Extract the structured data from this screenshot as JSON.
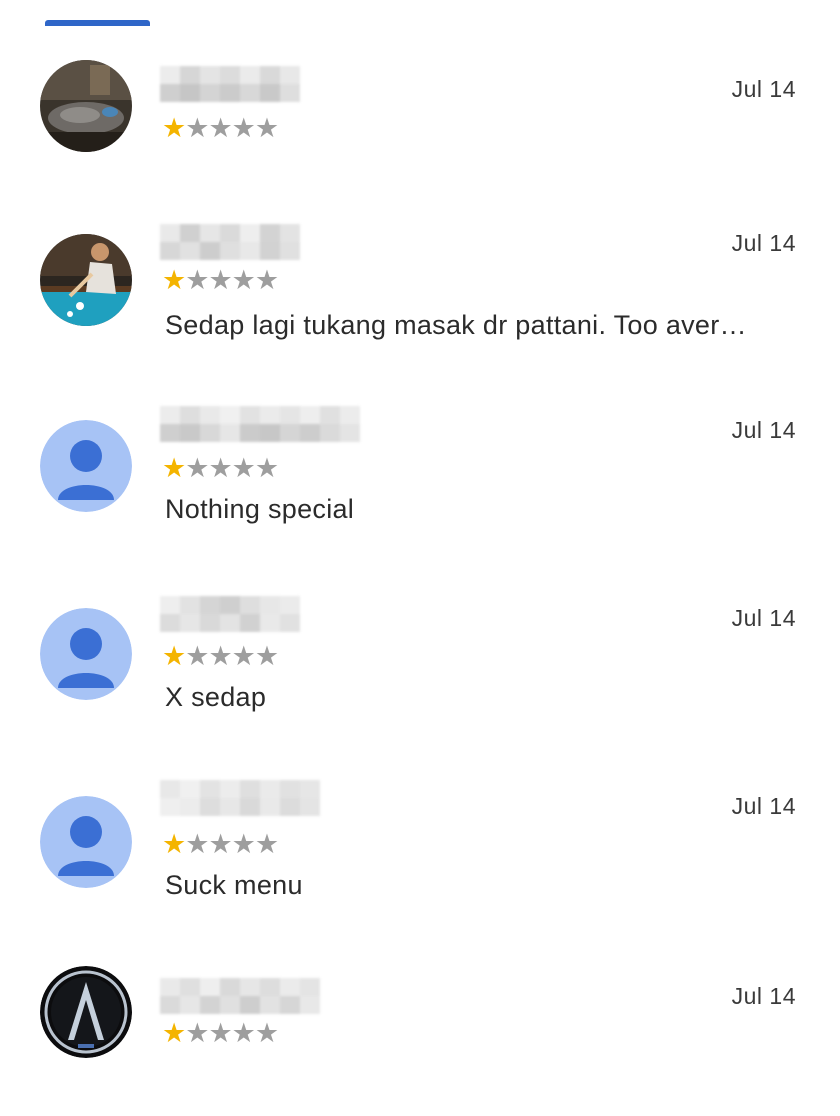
{
  "colors": {
    "accent": "#2f66c8",
    "star_filled": "#f4b400",
    "star_empty": "#9e9e9e",
    "avatar_default_bg": "#a7c3f5",
    "avatar_default_fg": "#3b6fd4"
  },
  "reviews": [
    {
      "avatar": "photo-avatar-dark-interior",
      "date": "Jul 14",
      "rating": 1,
      "rating_max": 5,
      "stars": "★★★★★",
      "text": ""
    },
    {
      "avatar": "photo-avatar-billiards-player",
      "date": "Jul 14",
      "rating": 1,
      "rating_max": 5,
      "stars": "★★★★★",
      "text": "Sedap lagi tukang masak dr pattani. Too aver…"
    },
    {
      "avatar": "default-person-avatar",
      "date": "Jul 14",
      "rating": 1,
      "rating_max": 5,
      "stars": "★★★★★",
      "text": "Nothing special"
    },
    {
      "avatar": "default-person-avatar",
      "date": "Jul 14",
      "rating": 1,
      "rating_max": 5,
      "stars": "★★★★★",
      "text": "X sedap"
    },
    {
      "avatar": "default-person-avatar",
      "date": "Jul 14",
      "rating": 1,
      "rating_max": 5,
      "stars": "★★★★★",
      "text": "Suck menu"
    },
    {
      "avatar": "car-logo-avatar",
      "date": "Jul 14",
      "rating": 1,
      "rating_max": 5,
      "stars": "★★★★★",
      "text": ""
    }
  ]
}
